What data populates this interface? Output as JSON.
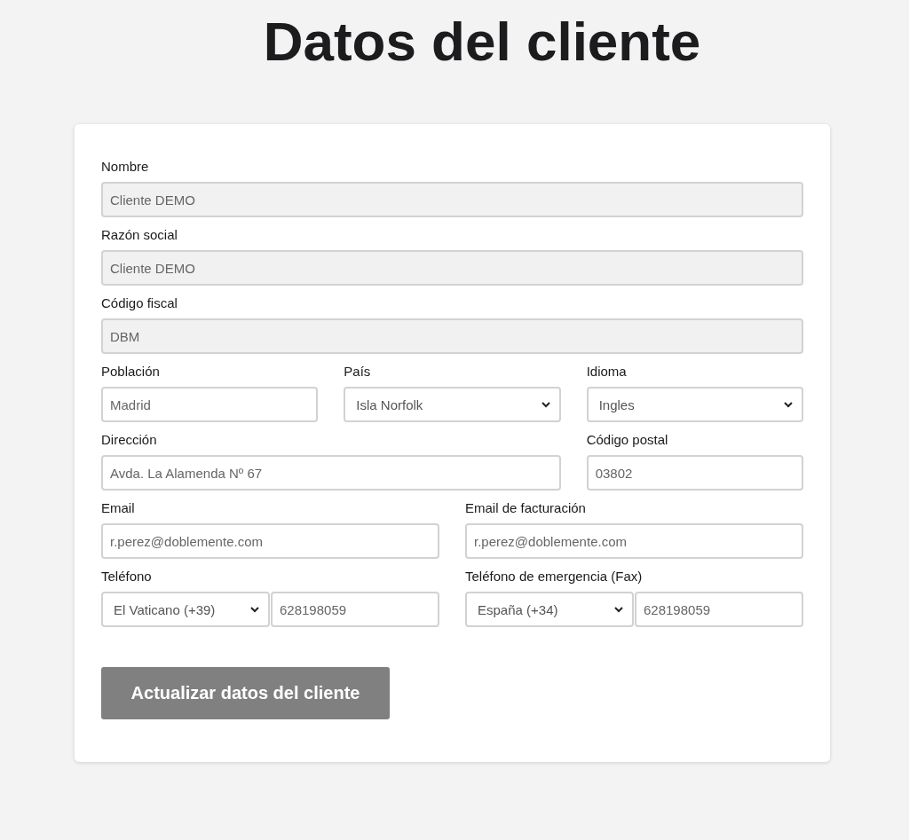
{
  "title": "Datos del cliente",
  "rows": [
    {
      "fields": [
        {
          "kind": "text",
          "label": "Nombre",
          "value": "Cliente DEMO",
          "disabled": true
        }
      ]
    },
    {
      "fields": [
        {
          "kind": "text",
          "label": "Razón social",
          "value": "Cliente DEMO",
          "disabled": true
        }
      ]
    },
    {
      "fields": [
        {
          "kind": "text",
          "label": "Código fiscal",
          "value": "DBM",
          "disabled": true
        }
      ]
    },
    {
      "fields": [
        {
          "kind": "text",
          "label": "Población",
          "value": "Madrid",
          "disabled": false
        },
        {
          "kind": "select",
          "label": "País",
          "value": "Isla Norfolk",
          "disabled": false
        },
        {
          "kind": "select",
          "label": "Idioma",
          "value": "Ingles",
          "disabled": false
        }
      ]
    },
    {
      "fields": [
        {
          "kind": "text",
          "label": "Dirección",
          "value": "Avda. La Alamenda Nº 67",
          "disabled": false,
          "wide": true
        },
        {
          "kind": "text",
          "label": "Código postal",
          "value": "03802",
          "disabled": false
        }
      ]
    },
    {
      "fields": [
        {
          "kind": "text",
          "label": "Email",
          "value": "r.perez@doblemente.com",
          "disabled": false
        },
        {
          "kind": "text",
          "label": "Email de facturación",
          "value": "r.perez@doblemente.com",
          "disabled": false
        }
      ]
    },
    {
      "fields": [
        {
          "kind": "phone",
          "label": "Teléfono",
          "prefix": "El Vaticano (+39)",
          "value": "628198059",
          "disabled": false
        },
        {
          "kind": "phone",
          "label": "Teléfono de emergencia (Fax)",
          "prefix": "España (+34)",
          "value": "628198059",
          "disabled": false
        }
      ]
    }
  ],
  "button": "Actualizar datos del cliente"
}
